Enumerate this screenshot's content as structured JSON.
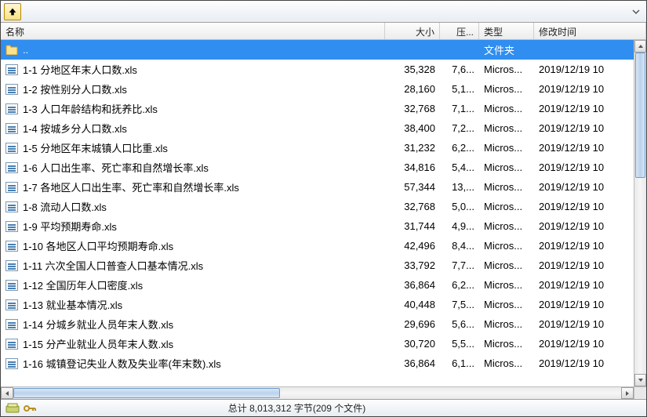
{
  "columns": {
    "name": "名称",
    "size": "大小",
    "compressed": "压...",
    "type": "类型",
    "modified": "修改时间"
  },
  "parent_row": {
    "name": "..",
    "type": "文件夹"
  },
  "files": [
    {
      "name": "1-1  分地区年末人口数.xls",
      "size": "35,328",
      "comp": "7,6...",
      "type": "Micros...",
      "date": "2019/12/19 10"
    },
    {
      "name": "1-2  按性别分人口数.xls",
      "size": "28,160",
      "comp": "5,1...",
      "type": "Micros...",
      "date": "2019/12/19 10"
    },
    {
      "name": "1-3  人口年龄结构和抚养比.xls",
      "size": "32,768",
      "comp": "7,1...",
      "type": "Micros...",
      "date": "2019/12/19 10"
    },
    {
      "name": "1-4  按城乡分人口数.xls",
      "size": "38,400",
      "comp": "7,2...",
      "type": "Micros...",
      "date": "2019/12/19 10"
    },
    {
      "name": "1-5  分地区年末城镇人口比重.xls",
      "size": "31,232",
      "comp": "6,2...",
      "type": "Micros...",
      "date": "2019/12/19 10"
    },
    {
      "name": "1-6  人口出生率、死亡率和自然增长率.xls",
      "size": "34,816",
      "comp": "5,4...",
      "type": "Micros...",
      "date": "2019/12/19 10"
    },
    {
      "name": "1-7  各地区人口出生率、死亡率和自然增长率.xls",
      "size": "57,344",
      "comp": "13,...",
      "type": "Micros...",
      "date": "2019/12/19 10"
    },
    {
      "name": "1-8  流动人口数.xls",
      "size": "32,768",
      "comp": "5,0...",
      "type": "Micros...",
      "date": "2019/12/19 10"
    },
    {
      "name": "1-9  平均预期寿命.xls",
      "size": "31,744",
      "comp": "4,9...",
      "type": "Micros...",
      "date": "2019/12/19 10"
    },
    {
      "name": "1-10  各地区人口平均预期寿命.xls",
      "size": "42,496",
      "comp": "8,4...",
      "type": "Micros...",
      "date": "2019/12/19 10"
    },
    {
      "name": "1-11  六次全国人口普查人口基本情况.xls",
      "size": "33,792",
      "comp": "7,7...",
      "type": "Micros...",
      "date": "2019/12/19 10"
    },
    {
      "name": "1-12  全国历年人口密度.xls",
      "size": "36,864",
      "comp": "6,2...",
      "type": "Micros...",
      "date": "2019/12/19 10"
    },
    {
      "name": "1-13  就业基本情况.xls",
      "size": "40,448",
      "comp": "7,5...",
      "type": "Micros...",
      "date": "2019/12/19 10"
    },
    {
      "name": "1-14  分城乡就业人员年末人数.xls",
      "size": "29,696",
      "comp": "5,6...",
      "type": "Micros...",
      "date": "2019/12/19 10"
    },
    {
      "name": "1-15  分产业就业人员年末人数.xls",
      "size": "30,720",
      "comp": "5,5...",
      "type": "Micros...",
      "date": "2019/12/19 10"
    },
    {
      "name": "1-16  城镇登记失业人数及失业率(年末数).xls",
      "size": "36,864",
      "comp": "6,1...",
      "type": "Micros...",
      "date": "2019/12/19 10"
    }
  ],
  "status": "总计 8,013,312 字节(209 个文件)"
}
